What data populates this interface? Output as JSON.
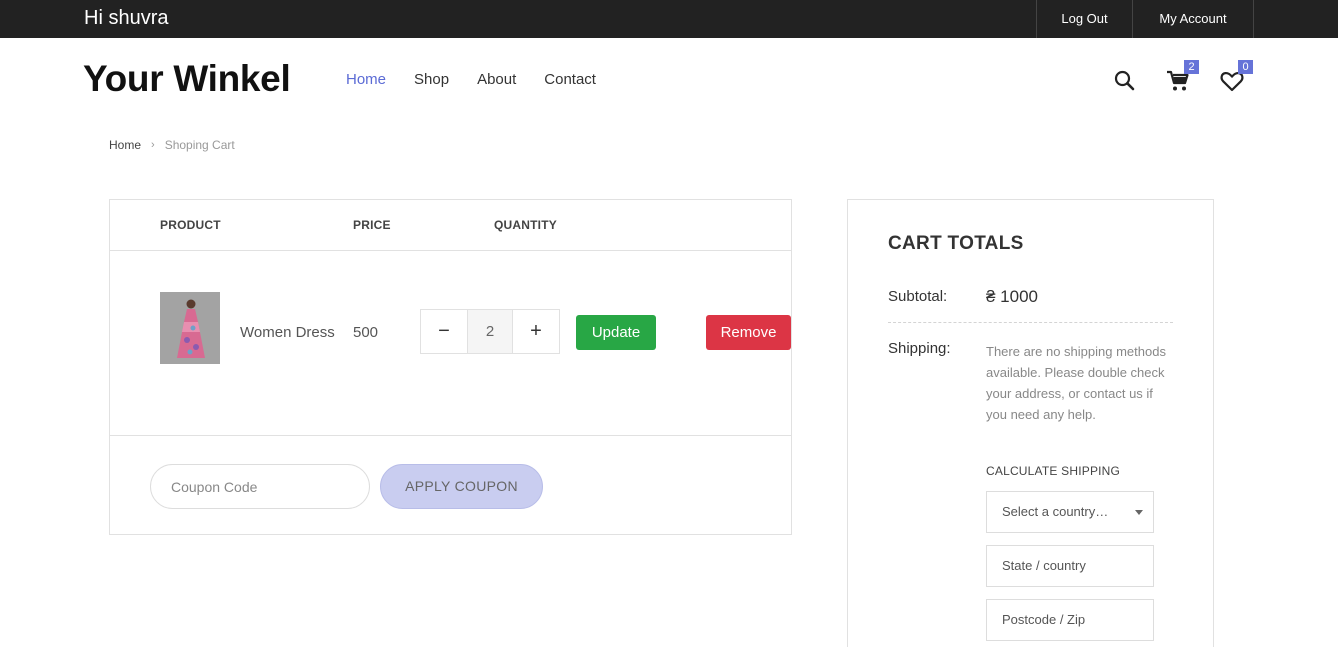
{
  "topbar": {
    "greeting": "Hi shuvra",
    "logout": "Log Out",
    "account": "My Account"
  },
  "header": {
    "brand": "Your Winkel",
    "nav": [
      "Home",
      "Shop",
      "About",
      "Contact"
    ],
    "active_nav": "Home",
    "cart_count": "2",
    "wishlist_count": "0",
    "icons": [
      "search-icon",
      "cart-icon",
      "heart-icon"
    ]
  },
  "breadcrumb": {
    "home": "Home",
    "current": "Shoping Cart"
  },
  "cart": {
    "columns": [
      "PRODUCT",
      "PRICE",
      "QUANTITY"
    ],
    "items": [
      {
        "name": "Women Dress",
        "price": "500",
        "quantity": "2"
      }
    ],
    "qty_minus": "−",
    "qty_plus": "+",
    "update_label": "Update",
    "remove_label": "Remove",
    "coupon_placeholder": "Coupon Code",
    "apply_label": "APPLY COUPON"
  },
  "totals": {
    "title": "CART TOTALS",
    "subtotal_label": "Subtotal:",
    "subtotal_value": "₴ 1000",
    "shipping_label": "Shipping:",
    "shipping_note": "There are no shipping methods available. Please double check your address, or contact us if you need any help.",
    "calc_label": "CALCULATE SHIPPING",
    "country_select": "Select a country…",
    "state_placeholder": "State /  country",
    "postcode_placeholder": "Postcode / Zip"
  },
  "colors": {
    "topbar": "#222222",
    "accent": "#5b6bd5",
    "badge": "#6673d8",
    "update": "#28a745",
    "remove": "#dc3545",
    "apply": "#c9cdf0"
  }
}
